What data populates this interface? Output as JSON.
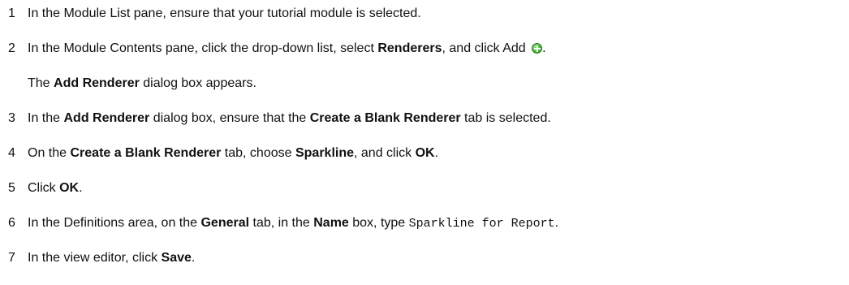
{
  "steps": [
    {
      "number": "1",
      "parts": [
        "In the Module List pane, ensure that your tutorial module is selected."
      ]
    },
    {
      "number": "2",
      "parts": [
        "In the Module Contents pane, click the drop-down list, select ",
        "Renderers",
        ", and click Add ",
        "."
      ],
      "icon": "add-green-plus-icon",
      "result": [
        "The ",
        "Add Renderer",
        " dialog box appears."
      ]
    },
    {
      "number": "3",
      "parts": [
        "In the ",
        "Add Renderer",
        " dialog box, ensure that the ",
        "Create a Blank Renderer",
        " tab is selected."
      ]
    },
    {
      "number": "4",
      "parts": [
        "On the ",
        "Create a Blank Renderer",
        " tab, choose ",
        "Sparkline",
        ", and click ",
        "OK",
        "."
      ]
    },
    {
      "number": "5",
      "parts": [
        "Click ",
        "OK",
        "."
      ]
    },
    {
      "number": "6",
      "parts": [
        "In the Definitions area, on the ",
        "General",
        " tab, in the ",
        "Name",
        " box, type ",
        "Sparkline for Report",
        "."
      ]
    },
    {
      "number": "7",
      "parts": [
        "In the view editor, click ",
        "Save",
        "."
      ]
    }
  ]
}
